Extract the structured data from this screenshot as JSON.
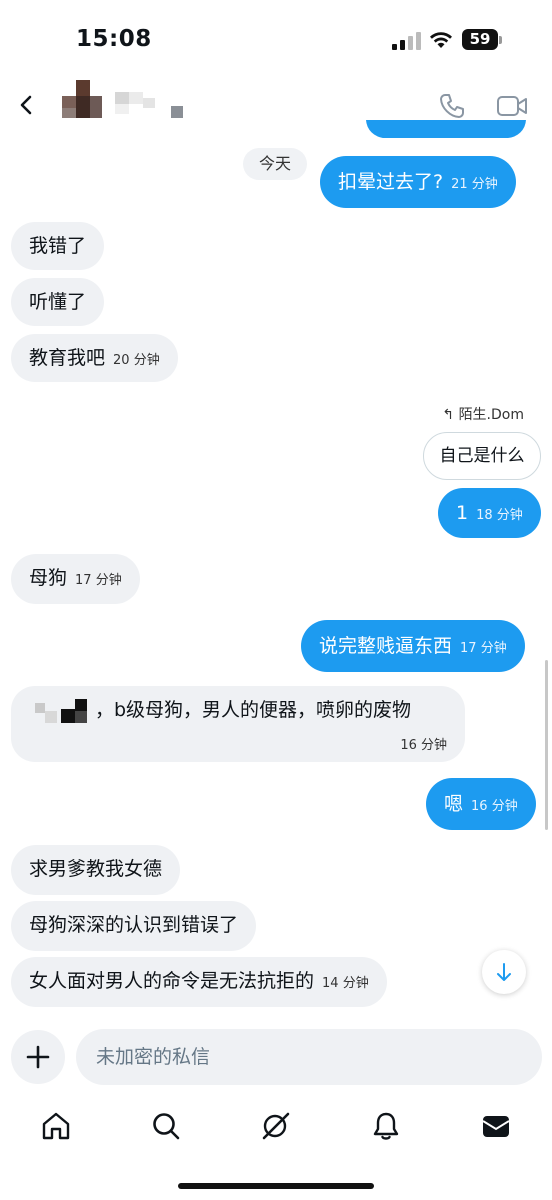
{
  "status_bar": {
    "time": "15:08",
    "battery": "59"
  },
  "header": {
    "back_icon": "back-arrow-icon",
    "call_icon": "phone-icon",
    "video_icon": "video-camera-icon"
  },
  "conversation": {
    "date_chip": "今天",
    "messages": [
      {
        "side": "out",
        "text": "扣晕过去了?",
        "time": "21 分钟"
      },
      {
        "side": "in",
        "text": "我错了",
        "time": ""
      },
      {
        "side": "in",
        "text": "听懂了",
        "time": ""
      },
      {
        "side": "in",
        "text": "教育我吧",
        "time": "20 分钟"
      },
      {
        "side": "out",
        "reply_to_label": "陌生.Dom",
        "reply_to_text": "自己是什么",
        "text": "1",
        "time": "18 分钟"
      },
      {
        "side": "in",
        "text": "母狗",
        "time": "17 分钟"
      },
      {
        "side": "out",
        "text": "说完整贱逼东西",
        "time": "17 分钟"
      },
      {
        "side": "in",
        "text": "，b级母狗，男人的便器，喷卵的废物",
        "time": "16 分钟"
      },
      {
        "side": "out",
        "text": "嗯",
        "time": "16 分钟"
      },
      {
        "side": "in",
        "text": "求男爹教我女德",
        "time": ""
      },
      {
        "side": "in",
        "text": "母狗深深的认识到错误了",
        "time": ""
      },
      {
        "side": "in",
        "text": "女人面对男人的命令是无法抗拒的",
        "time": "14 分钟"
      }
    ]
  },
  "composer": {
    "placeholder": "未加密的私信",
    "value": ""
  },
  "tab_bar": {
    "items": [
      "home-icon",
      "search-icon",
      "grok-icon",
      "notifications-bell-icon",
      "messages-envelope-icon"
    ]
  },
  "colors": {
    "accent": "#1d9bf0",
    "incoming_bubble": "#eff1f4"
  }
}
